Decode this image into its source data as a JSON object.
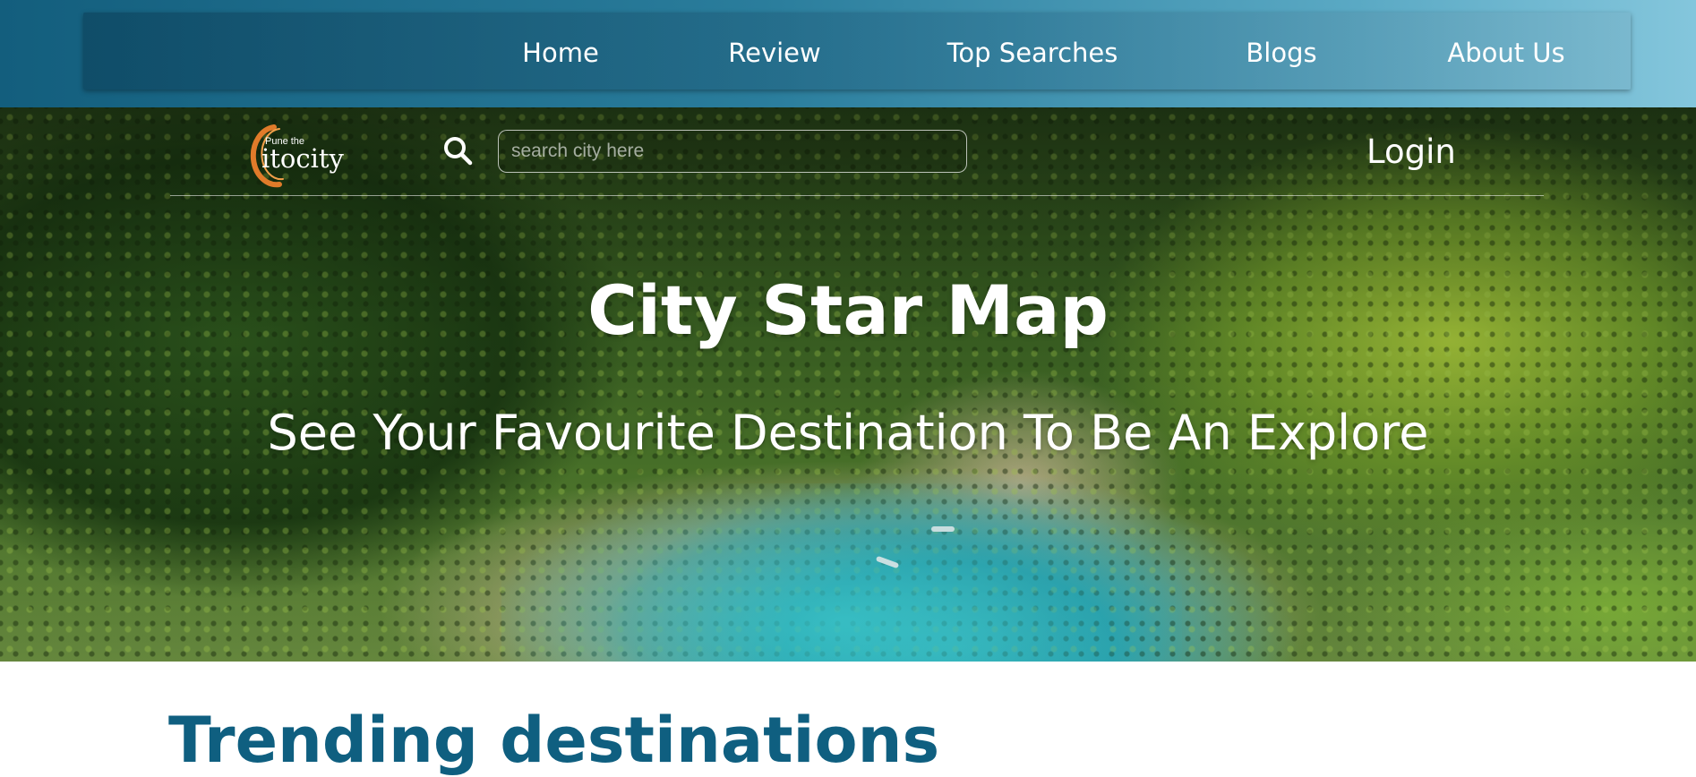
{
  "nav": {
    "items": [
      {
        "label": "Home"
      },
      {
        "label": "Review"
      },
      {
        "label": "Top Searches"
      },
      {
        "label": "Blogs"
      },
      {
        "label": "About Us"
      }
    ]
  },
  "header": {
    "logo": {
      "small_text": "Pune the",
      "big_text": "itocity",
      "ring_color": "#e07b2a"
    },
    "search": {
      "placeholder": "search city here",
      "value": "",
      "icon": "search-icon"
    },
    "login_label": "Login"
  },
  "hero": {
    "title": "City Star Map",
    "subtitle": "See Your Favourite Destination To Be An Explore"
  },
  "main": {
    "section_title": "Trending destinations"
  },
  "colors": {
    "nav_gradient_start": "#135e7d",
    "nav_gradient_end": "#84c6dc",
    "section_title": "#0f5f80",
    "text_light": "#ffffff"
  }
}
